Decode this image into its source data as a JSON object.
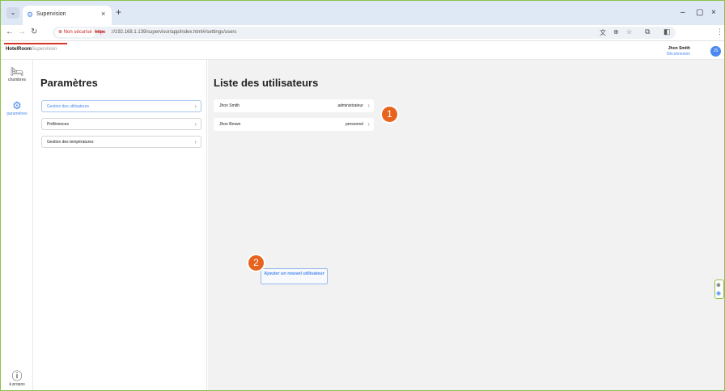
{
  "browser": {
    "tab_title": "Supervision",
    "new_tab_symbol": "+",
    "tab_close_symbol": "×",
    "insecure_label": "Non sécurisé",
    "url_scheme": "https",
    "url_rest": "://192.168.1.139/supervisor/app/index.html#/settings/users",
    "window_controls": {
      "minimize": "–",
      "restore": "▢",
      "close": "×"
    }
  },
  "app": {
    "brand_bold": "HotelRoom",
    "brand_light": "Supervision",
    "user_name": "Jhon Smith",
    "logout_label": "Déconnexion",
    "avatar_initials": "JS",
    "accent_color": "#4a88ef",
    "brand_underline_color": "#d9342b"
  },
  "leftnav": {
    "items": [
      {
        "label": "chambres",
        "icon": "bed-icon"
      },
      {
        "label": "paramètres",
        "icon": "gear-icon"
      },
      {
        "label": "à propos",
        "icon": "help-icon"
      }
    ]
  },
  "settings": {
    "title": "Paramètres",
    "menu": [
      {
        "label": "Gestion des utilisateurs",
        "active": true
      },
      {
        "label": "Préférences",
        "active": false
      },
      {
        "label": "Gestion des températures",
        "active": false
      }
    ]
  },
  "users": {
    "title": "Liste des utilisateurs",
    "rows": [
      {
        "name": "Jhon Smith",
        "role": "administrateur"
      },
      {
        "name": "Jhon Brown",
        "role": "personnel"
      }
    ],
    "add_button": "Ajouter un nouvel utilisateur"
  },
  "callouts": [
    "1",
    "2"
  ],
  "callout_color": "#e8631e"
}
